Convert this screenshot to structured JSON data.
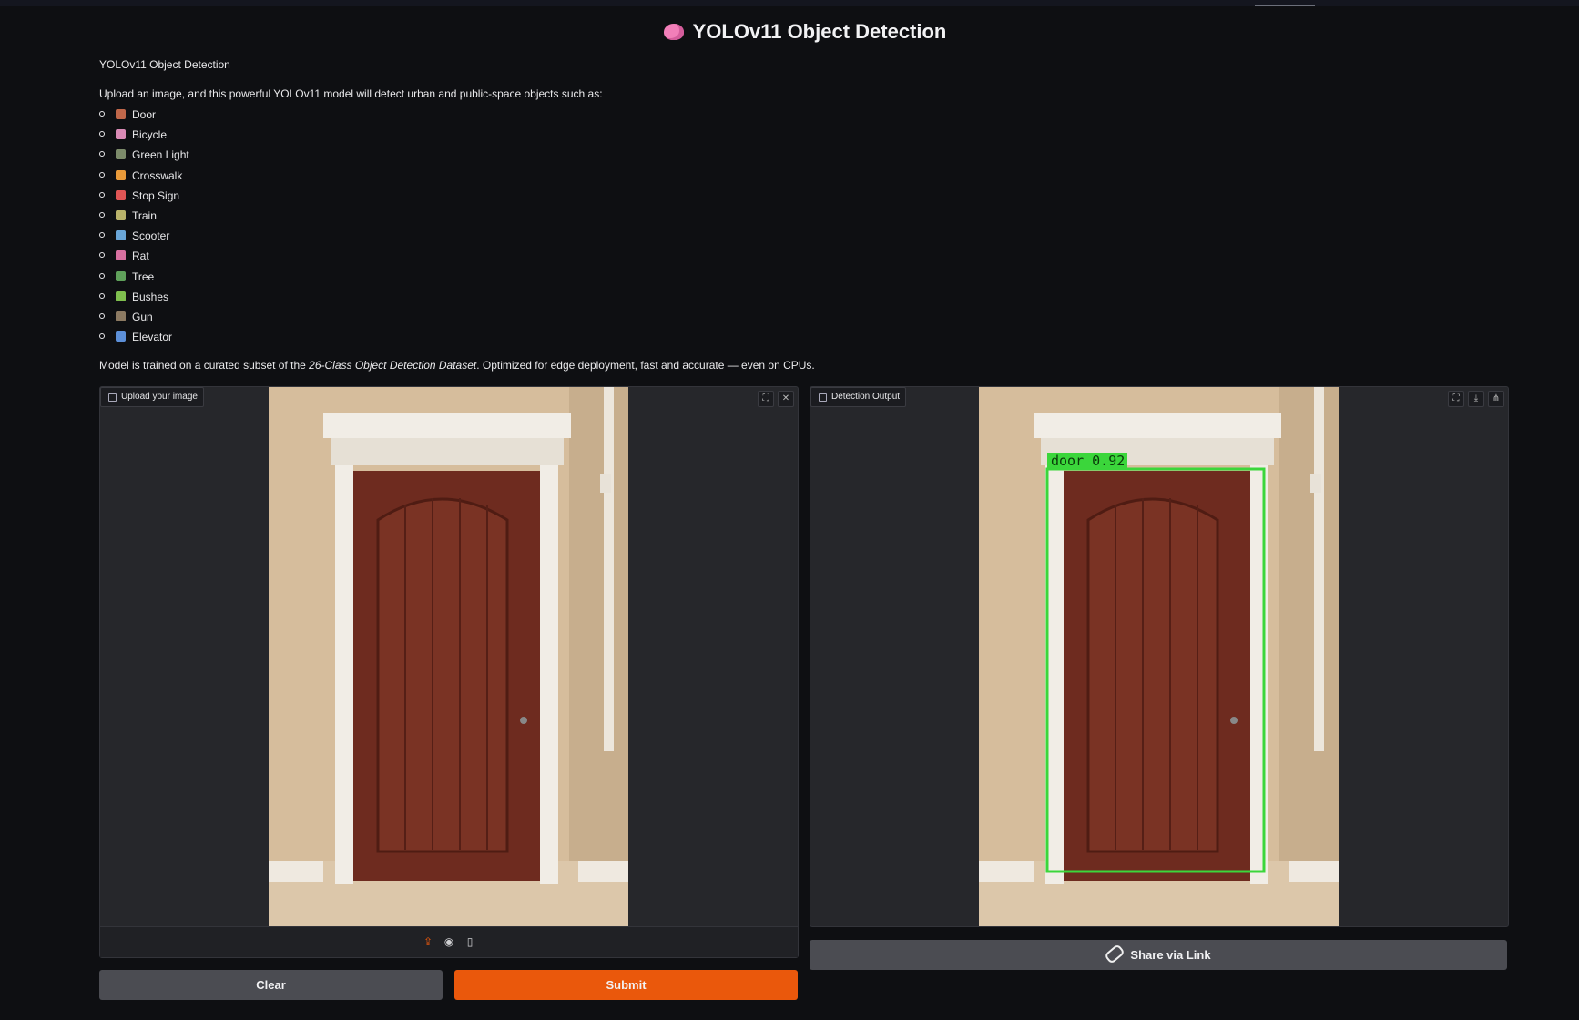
{
  "app": {
    "title": "YOLOv11 Object Detection",
    "subtitle": "YOLOv11 Object Detection",
    "intro": "Upload an image, and this powerful YOLOv11 model will detect urban and public-space objects such as:"
  },
  "classes": [
    {
      "label": "Door",
      "icon": "door-icon",
      "color": "#c0674a"
    },
    {
      "label": "Bicycle",
      "icon": "bicycle-icon",
      "color": "#d98ab5"
    },
    {
      "label": "Green Light",
      "icon": "traffic-light-icon",
      "color": "#7c8b6a"
    },
    {
      "label": "Crosswalk",
      "icon": "crosswalk-icon",
      "color": "#e99a3a"
    },
    {
      "label": "Stop Sign",
      "icon": "stop-sign-icon",
      "color": "#e05555"
    },
    {
      "label": "Train",
      "icon": "train-icon",
      "color": "#b9b36a"
    },
    {
      "label": "Scooter",
      "icon": "scooter-icon",
      "color": "#6aa6d8"
    },
    {
      "label": "Rat",
      "icon": "rat-icon",
      "color": "#d870a0"
    },
    {
      "label": "Tree",
      "icon": "tree-icon",
      "color": "#5fa05a"
    },
    {
      "label": "Bushes",
      "icon": "bush-icon",
      "color": "#7fbf4e"
    },
    {
      "label": "Gun",
      "icon": "gun-icon",
      "color": "#8c7a62"
    },
    {
      "label": "Elevator",
      "icon": "elevator-icon",
      "color": "#5c8fd8"
    }
  ],
  "footnote": {
    "before": "Model is trained on a curated subset of the ",
    "dataset": "26-Class Object Detection Dataset",
    "after": ". Optimized for edge deployment, fast and accurate — even on CPUs."
  },
  "input_panel": {
    "label": "Upload your image"
  },
  "output_panel": {
    "label": "Detection Output",
    "detection": {
      "class": "door",
      "confidence": "0.92",
      "box_color": "#3bd63b"
    }
  },
  "buttons": {
    "clear": "Clear",
    "submit": "Submit",
    "share": "Share via Link"
  },
  "colors": {
    "accent": "#ea580c",
    "background": "#0e0f12",
    "panel": "#26272b"
  }
}
